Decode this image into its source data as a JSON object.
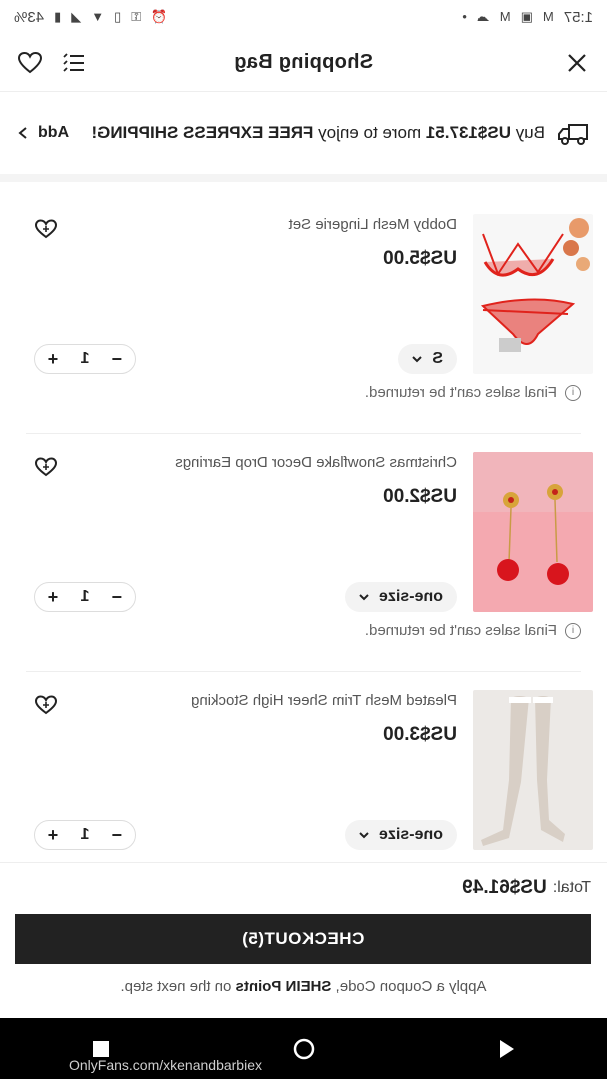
{
  "status_bar": {
    "time": "1:57",
    "battery": "43%"
  },
  "header": {
    "title": "Shopping Bag"
  },
  "promo": {
    "prefix": "Buy",
    "amount": "US$137.51",
    "middle": "more to enjoy",
    "highlight": "FREE EXPRESS SHIPPING!",
    "add_label": "Add"
  },
  "items": [
    {
      "name": "Dobby Mesh Lingerie Set",
      "price": "US$5.00",
      "size": "S",
      "quantity": "1",
      "note": "Final sales can't be returned."
    },
    {
      "name": "Christmas Snowflake Decor Drop Earrings",
      "price": "US$2.00",
      "size": "one-size",
      "quantity": "1",
      "note": "Final sales can't be returned."
    },
    {
      "name": "Pleated Mesh Trim Sheer High Stocking",
      "price": "US$3.00",
      "size": "one-size",
      "quantity": "1",
      "note": ""
    }
  ],
  "footer": {
    "total_label": "Total:",
    "total_value": "US$61.49",
    "checkout_label": "CHECKOUT(5)",
    "coupon_prefix": "Apply a Coupon Code,",
    "coupon_bold": "SHEIN Points",
    "coupon_suffix": "on the next step."
  },
  "watermark": "OnlyFans.com/xkenandbarbiex"
}
